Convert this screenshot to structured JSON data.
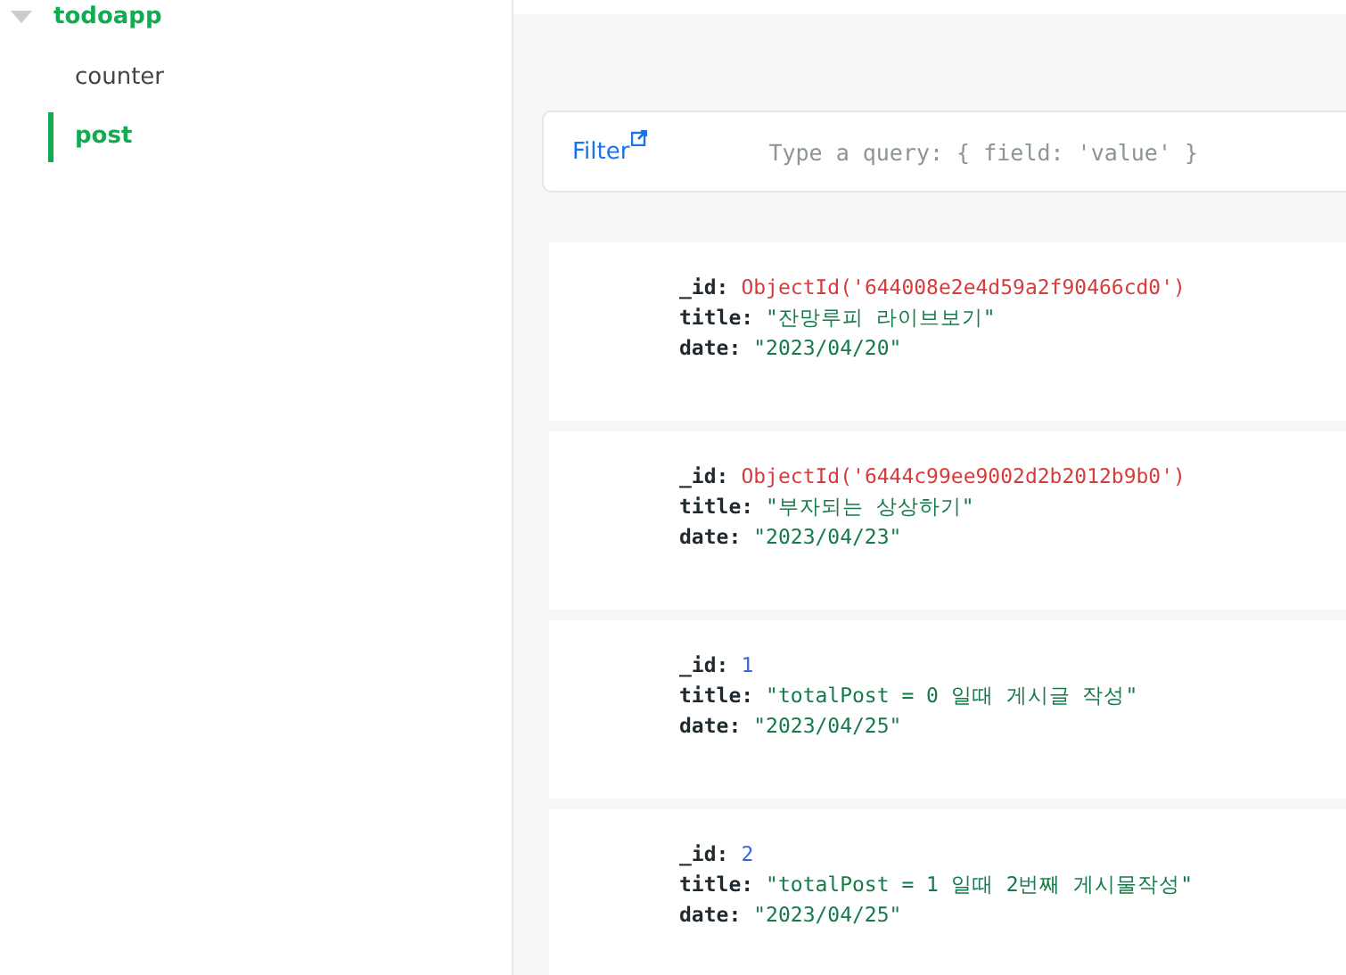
{
  "sidebar": {
    "database": {
      "name": "todoapp",
      "expanded": true
    },
    "collections": [
      {
        "name": "counter",
        "selected": false
      },
      {
        "name": "post",
        "selected": true
      }
    ]
  },
  "filter": {
    "label": "Filter",
    "placeholder": "Type a query: { field: 'value' }"
  },
  "documents": [
    {
      "fields": [
        {
          "key": "_id:",
          "kind": "objectid",
          "value": "ObjectId('644008e2e4d59a2f90466cd0')"
        },
        {
          "key": "title:",
          "kind": "string",
          "value": "\"잔망루피 라이브보기\""
        },
        {
          "key": "date:",
          "kind": "string",
          "value": "\"2023/04/20\""
        }
      ]
    },
    {
      "fields": [
        {
          "key": "_id:",
          "kind": "objectid",
          "value": "ObjectId('6444c99ee9002d2b2012b9b0')"
        },
        {
          "key": "title:",
          "kind": "string",
          "value": "\"부자되는 상상하기\""
        },
        {
          "key": "date:",
          "kind": "string",
          "value": "\"2023/04/23\""
        }
      ]
    },
    {
      "fields": [
        {
          "key": "_id:",
          "kind": "number",
          "value": "1"
        },
        {
          "key": "title:",
          "kind": "string",
          "value": "\"totalPost = 0 일때 게시글 작성\""
        },
        {
          "key": "date:",
          "kind": "string",
          "value": "\"2023/04/25\""
        }
      ]
    },
    {
      "fields": [
        {
          "key": "_id:",
          "kind": "number",
          "value": "2"
        },
        {
          "key": "title:",
          "kind": "string",
          "value": "\"totalPost = 1 일때 2번째 게시물작성\""
        },
        {
          "key": "date:",
          "kind": "string",
          "value": "\"2023/04/25\""
        }
      ]
    }
  ]
}
